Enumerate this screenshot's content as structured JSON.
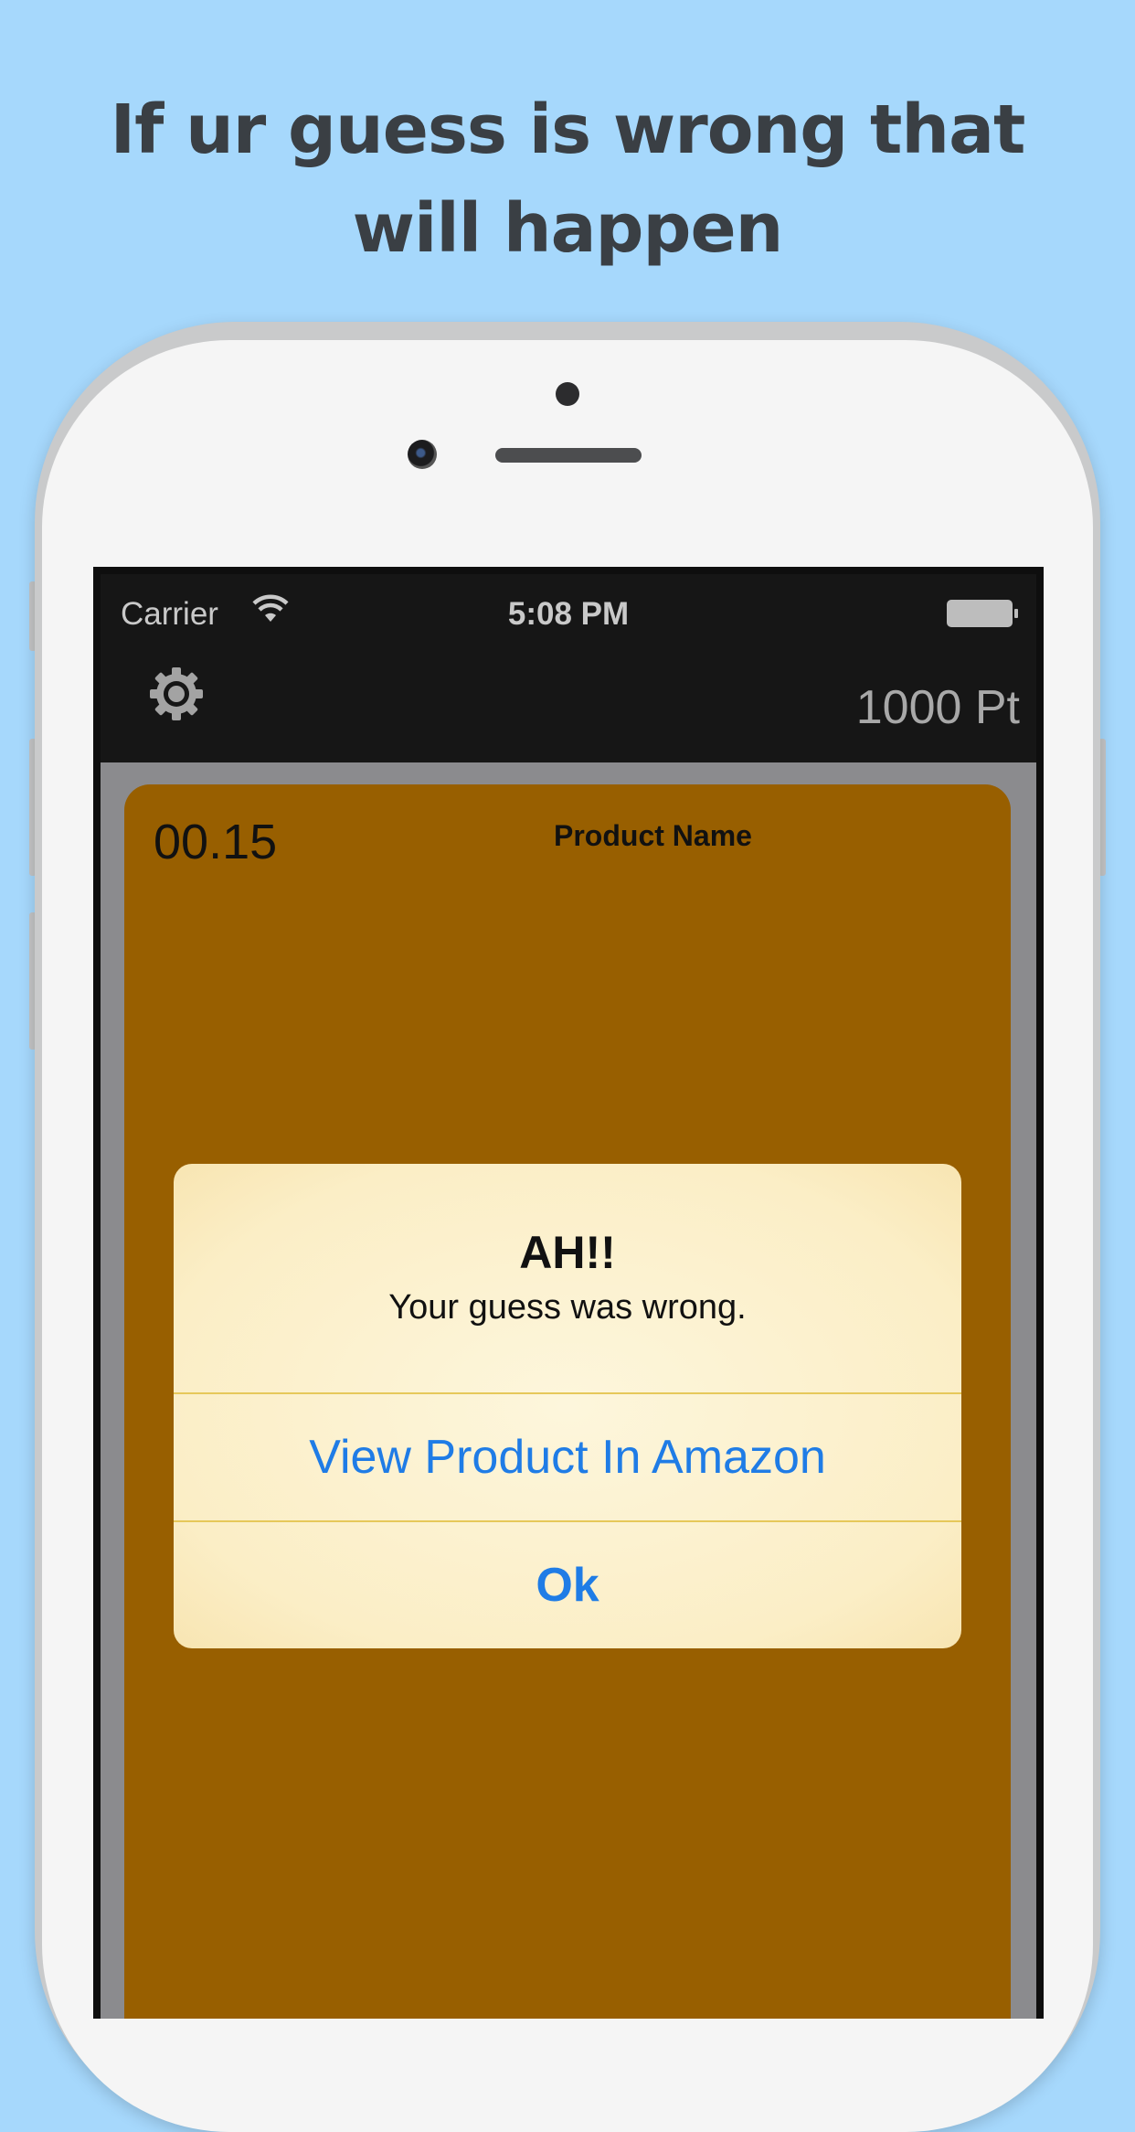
{
  "caption": "If ur guess is wrong that will happen",
  "status_bar": {
    "carrier": "Carrier",
    "time": "5:08 PM"
  },
  "nav": {
    "settings_icon": "gear-icon",
    "points": "1000 Pt"
  },
  "game": {
    "timer": "00.15",
    "product_name": "Product Name",
    "card_color": "#985f00"
  },
  "alert": {
    "title": "AH!!",
    "message": "Your guess was wrong.",
    "buttons": {
      "view_product": "View Product In Amazon",
      "ok": "Ok"
    },
    "button_color": "#1f7ce6"
  },
  "colors": {
    "background": "#a6d8fc",
    "bar": "#161616"
  }
}
